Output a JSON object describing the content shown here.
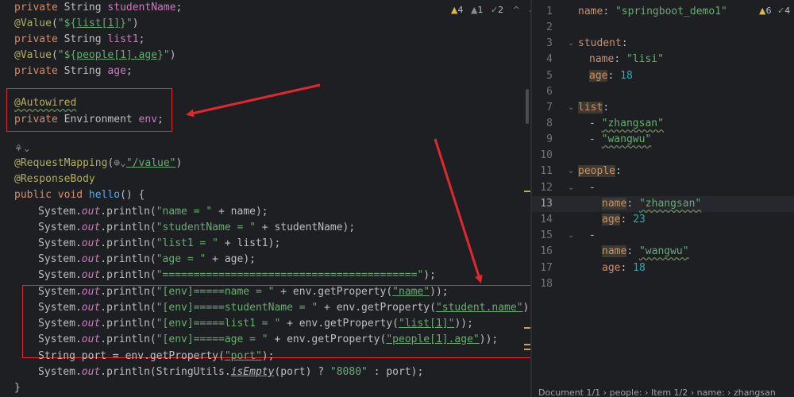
{
  "java_inspections": {
    "warnings": "4",
    "weak_warnings": "1",
    "ok_checks": "2"
  },
  "yaml_inspections": {
    "warnings": "6",
    "ok_checks": "4"
  },
  "java": {
    "l1": {
      "kw": "private ",
      "type": "String ",
      "name": "studentName",
      "end": ";"
    },
    "l2": {
      "ann": "@Value",
      "open": "(",
      "str_a": "\"${",
      "str_b": "list[1]",
      "str_c": "}\"",
      "close": ")"
    },
    "l3": {
      "kw": "private ",
      "type": "String ",
      "name": "list1",
      "end": ";"
    },
    "l4": {
      "ann": "@Value",
      "open": "(",
      "str_a": "\"${",
      "str_b": "people[1].age",
      "str_c": "}\"",
      "close": ")"
    },
    "l5": {
      "kw": "private ",
      "type": "String ",
      "name": "age",
      "end": ";"
    },
    "l6": {
      "ann": "@Autowired"
    },
    "l7": {
      "kw": "private ",
      "type": "Environment ",
      "name": "env",
      "end": ";"
    },
    "l8": {
      "icon_label": "⚘⌄"
    },
    "l9": {
      "ann": "@RequestMapping",
      "open": "(",
      "globe": "⊕⌄",
      "str": "\"/value\"",
      "close": ")"
    },
    "l10": {
      "ann": "@ResponseBody"
    },
    "l11": {
      "kw": "public void ",
      "meth": "hello",
      "rest": "() {"
    },
    "prints": [
      {
        "pre": "System.",
        "out": "out",
        "mid": ".println(",
        "str": "\"name = \"",
        "rest": " + name);"
      },
      {
        "pre": "System.",
        "out": "out",
        "mid": ".println(",
        "str": "\"studentName = \"",
        "rest": " + studentName);"
      },
      {
        "pre": "System.",
        "out": "out",
        "mid": ".println(",
        "str": "\"list1 = \"",
        "rest": " + list1);"
      },
      {
        "pre": "System.",
        "out": "out",
        "mid": ".println(",
        "str": "\"age = \"",
        "rest": " + age);"
      },
      {
        "pre": "System.",
        "out": "out",
        "mid": ".println(",
        "str": "\"=========================================\"",
        "rest": ");"
      }
    ],
    "env_prints": [
      {
        "pre": "System.",
        "out": "out",
        "mid": ".println(",
        "str": "\"[env]=====name = \"",
        "mid2": " + env.getProperty(",
        "arg": "\"name\"",
        "rest": "));"
      },
      {
        "pre": "System.",
        "out": "out",
        "mid": ".println(",
        "str": "\"[env]=====studentName = \"",
        "mid2": " + env.getProperty(",
        "arg": "\"student.name\"",
        "rest": "))"
      },
      {
        "pre": "System.",
        "out": "out",
        "mid": ".println(",
        "str": "\"[env]=====list1 = \"",
        "mid2": " + env.getProperty(",
        "arg": "\"list[1]\"",
        "rest": "));"
      },
      {
        "pre": "System.",
        "out": "out",
        "mid": ".println(",
        "str": "\"[env]=====age = \"",
        "mid2": " + env.getProperty(",
        "arg": "\"people[1].age\"",
        "rest": "));"
      }
    ],
    "port_line": {
      "type": "String ",
      "var": "port = env.getProperty(",
      "arg": "\"port\"",
      "rest": ");"
    },
    "last_print": {
      "pre": "System.",
      "out": "out",
      "mid": ".println(StringUtils.",
      "meth": "isEmpty",
      "mid2": "(port) ? ",
      "str": "\"8080\"",
      "rest": " : port);"
    },
    "closing": "}"
  },
  "yaml": {
    "line_numbers": [
      "1",
      "2",
      "3",
      "4",
      "5",
      "6",
      "7",
      "8",
      "9",
      "10",
      "11",
      "12",
      "13",
      "14",
      "15",
      "16",
      "17",
      "18"
    ],
    "l1": {
      "key": "name",
      "sep": ": ",
      "val": "\"springboot_demo1\""
    },
    "l3": {
      "key": "student",
      "sep": ":"
    },
    "l4": {
      "key": "name",
      "sep": ": ",
      "val": "\"lisi\""
    },
    "l5": {
      "key": "age",
      "sep": ": ",
      "val": "18"
    },
    "l7": {
      "key": "list",
      "sep": ":"
    },
    "l8": {
      "dash": "- ",
      "val": "\"zhangsan\""
    },
    "l9": {
      "dash": "- ",
      "val": "\"wangwu\""
    },
    "l11": {
      "key": "people",
      "sep": ":"
    },
    "l12": {
      "dash": "-"
    },
    "l13": {
      "key": "name",
      "sep": ": ",
      "val": "\"zhangsan\""
    },
    "l14": {
      "key": "age",
      "sep": ": ",
      "val": "23"
    },
    "l15": {
      "dash": "-"
    },
    "l16": {
      "key": "name",
      "sep": ": ",
      "val": "\"wangwu\""
    },
    "l17": {
      "key": "age",
      "sep": ": ",
      "val": "18"
    }
  },
  "breadcrumb": {
    "doc": "Document 1/1",
    "sep": " › ",
    "people": "people:",
    "item": "Item 1/2",
    "name": "name:",
    "value": "zhangsan"
  },
  "colors": {
    "annotation_box": "#e0282e",
    "arrow": "#e0282e",
    "background": "#1e1f22"
  }
}
